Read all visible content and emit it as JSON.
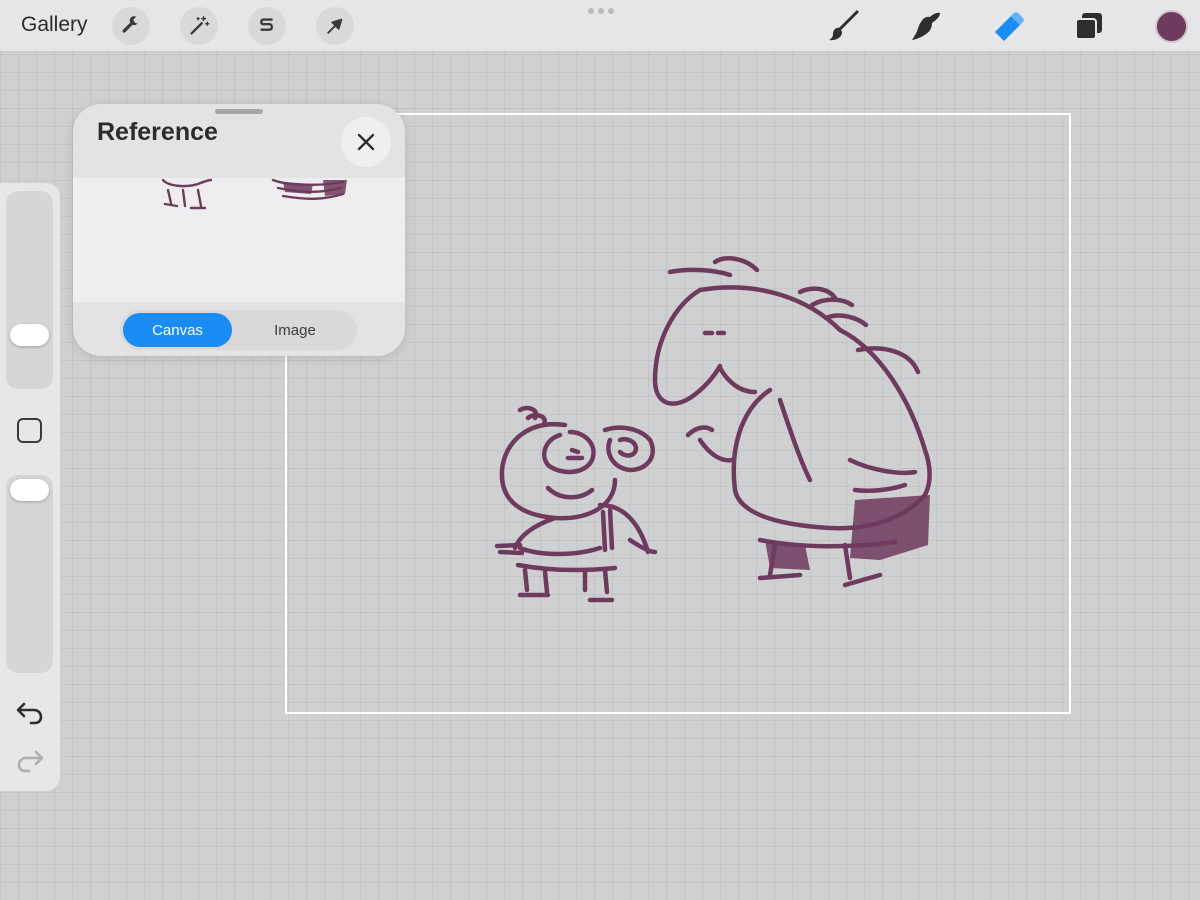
{
  "toolbar": {
    "gallery_label": "Gallery",
    "left_tools": [
      "wrench-icon",
      "magic-wand-icon",
      "selection-icon",
      "transform-arrow-icon"
    ],
    "right_tools": [
      "brush-icon",
      "smudge-icon",
      "eraser-icon",
      "layers-icon"
    ],
    "active_tool": "eraser-icon",
    "current_color": "#6e3a5d"
  },
  "reference_panel": {
    "title": "Reference",
    "tabs": [
      {
        "label": "Canvas",
        "active": true
      },
      {
        "label": "Image",
        "active": false
      }
    ]
  },
  "sidebar": {
    "brush_size_level": 0.75,
    "opacity_level": 0.0,
    "buttons": [
      "modify-button",
      "undo-icon",
      "redo-icon"
    ]
  },
  "colors": {
    "accent": "#1a8cf5",
    "stroke": "#6e3a5d",
    "eraser_active": "#1a8cf5"
  }
}
